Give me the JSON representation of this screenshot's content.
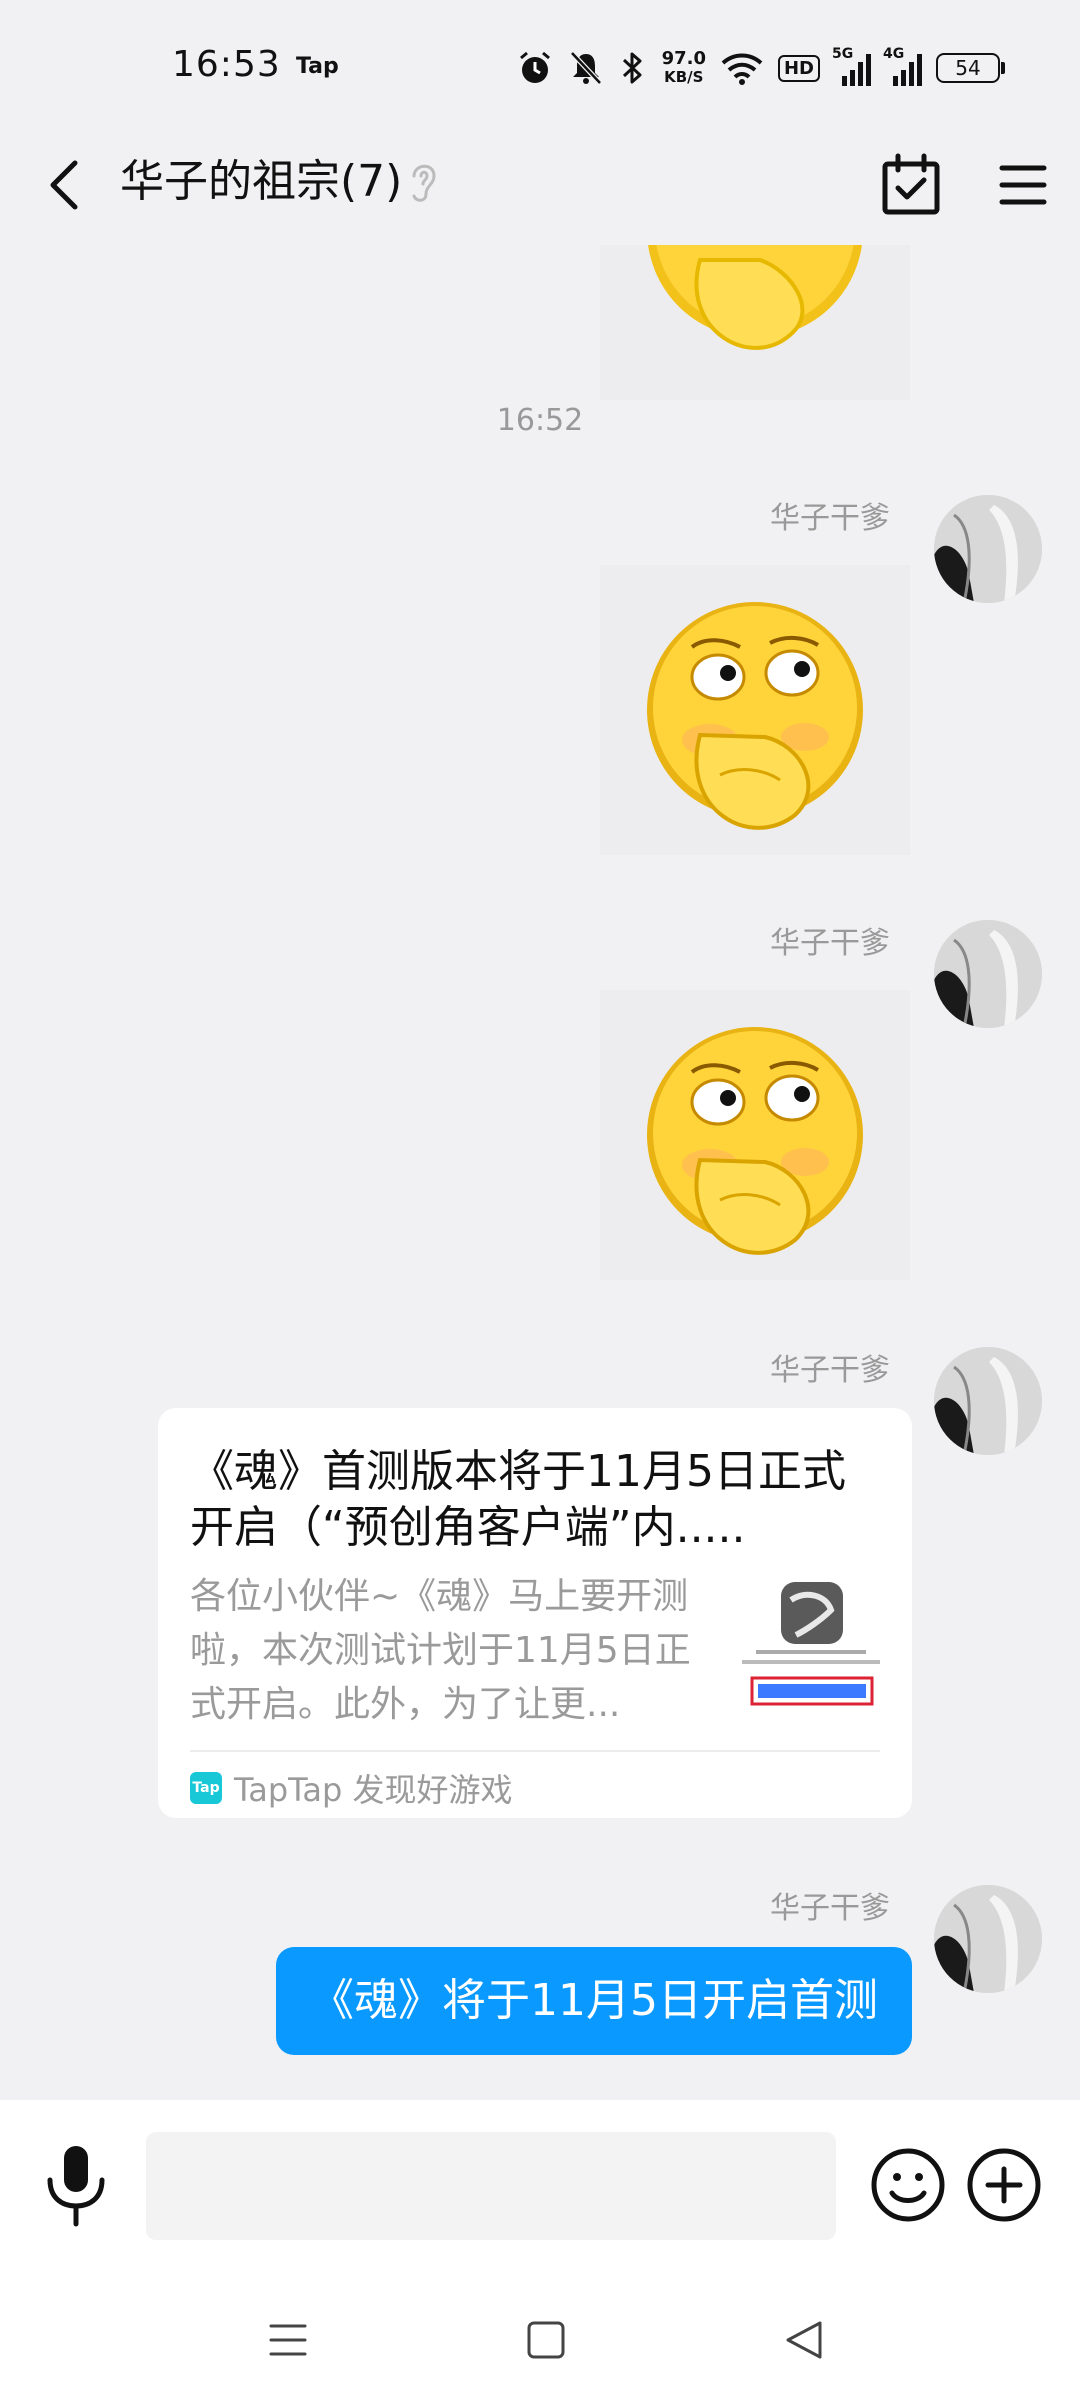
{
  "status_bar": {
    "time": "16:53",
    "app_indicator": "Tap",
    "net_speed_value": "97.0",
    "net_speed_unit": "KB/S",
    "hd_label": "HD",
    "sim1_label": "5G",
    "sim2_label": "4G",
    "battery": "54",
    "icons": [
      "alarm-icon",
      "mute-icon",
      "bluetooth-icon",
      "wifi-icon",
      "hd-icon",
      "signal-5g-icon",
      "signal-4g-icon",
      "battery-icon"
    ]
  },
  "header": {
    "title": "华子的祖宗(7)",
    "icons": [
      "back-icon",
      "ear-icon",
      "calendar-check-icon",
      "menu-icon"
    ]
  },
  "chat": {
    "timestamp": "16:52",
    "messages": [
      {
        "type": "sticker",
        "sender": "华子干爹",
        "sticker": "shy-emoji"
      },
      {
        "type": "sticker",
        "sender": "华子干爹",
        "sticker": "shy-emoji"
      },
      {
        "type": "link",
        "sender": "华子干爹",
        "title": "《魂》首测版本将于11月5日正式开启（“预创角客户端”内.....",
        "description": "各位小伙伴~《魂》马上要开测啦，本次测试计划于11月5日正式开启。此外，为了让更...",
        "source_logo": "Tap",
        "source": "TapTap 发现好游戏"
      },
      {
        "type": "text",
        "sender": "华子干爹",
        "text": "《魂》将于11月5日开启首测"
      }
    ]
  },
  "input_bar": {
    "placeholder": "",
    "value": "",
    "icons": [
      "microphone-icon",
      "emoji-icon",
      "plus-icon"
    ]
  },
  "nav_bar": {
    "icons": [
      "recent-apps-icon",
      "home-icon",
      "back-triangle-icon"
    ]
  },
  "colors": {
    "background": "#f1f1f3",
    "bubble_blue": "#0a99ff",
    "secondary_text": "#999999",
    "taptap_brand": "#19c8d6"
  }
}
